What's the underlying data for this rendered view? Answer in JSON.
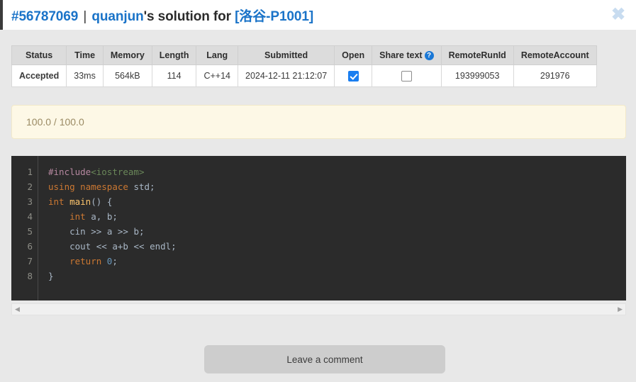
{
  "header": {
    "submission_id": "#56787069",
    "separator": "|",
    "username": "quanjun",
    "possessive": "'s solution for ",
    "problem": "[洛谷-P1001]",
    "close_icon": "close-icon",
    "close_glyph": "✖"
  },
  "result_table": {
    "columns": [
      "Status",
      "Time",
      "Memory",
      "Length",
      "Lang",
      "Submitted",
      "Open",
      "Share text",
      "RemoteRunId",
      "RemoteAccount"
    ],
    "share_text_help_glyph": "?",
    "row": {
      "status": "Accepted",
      "time": "33ms",
      "memory": "564kB",
      "length": "114",
      "lang": "C++14",
      "submitted": "2024-12-11 21:12:07",
      "open_checked": true,
      "share_text_checked": false,
      "remote_run_id": "193999053",
      "remote_account": "291976"
    }
  },
  "score_panel": {
    "text": "100.0 / 100.0"
  },
  "code": {
    "line_numbers": [
      "1",
      "2",
      "3",
      "4",
      "5",
      "6",
      "7",
      "8"
    ],
    "lines": [
      "#include<iostream>",
      "using namespace std;",
      "int main() {",
      "    int a, b;",
      "    cin >> a >> b;",
      "    cout << a+b << endl;",
      "    return 0;",
      "}"
    ],
    "language": "C++14"
  },
  "scrollbar": {
    "left_arrow": "◀",
    "right_arrow": "▶"
  },
  "comment_button": {
    "label": "Leave a comment"
  },
  "colors": {
    "link": "#1a73c8",
    "accepted": "#4caf50",
    "checkbox_checked": "#1a7ef0",
    "score_bg": "#fdf8e6",
    "score_text": "#9a8a63",
    "code_bg": "#2b2b2b",
    "page_bg": "#e8e8e8",
    "button_bg": "#cdcdcd",
    "close_icon": "#c8dcf0"
  }
}
